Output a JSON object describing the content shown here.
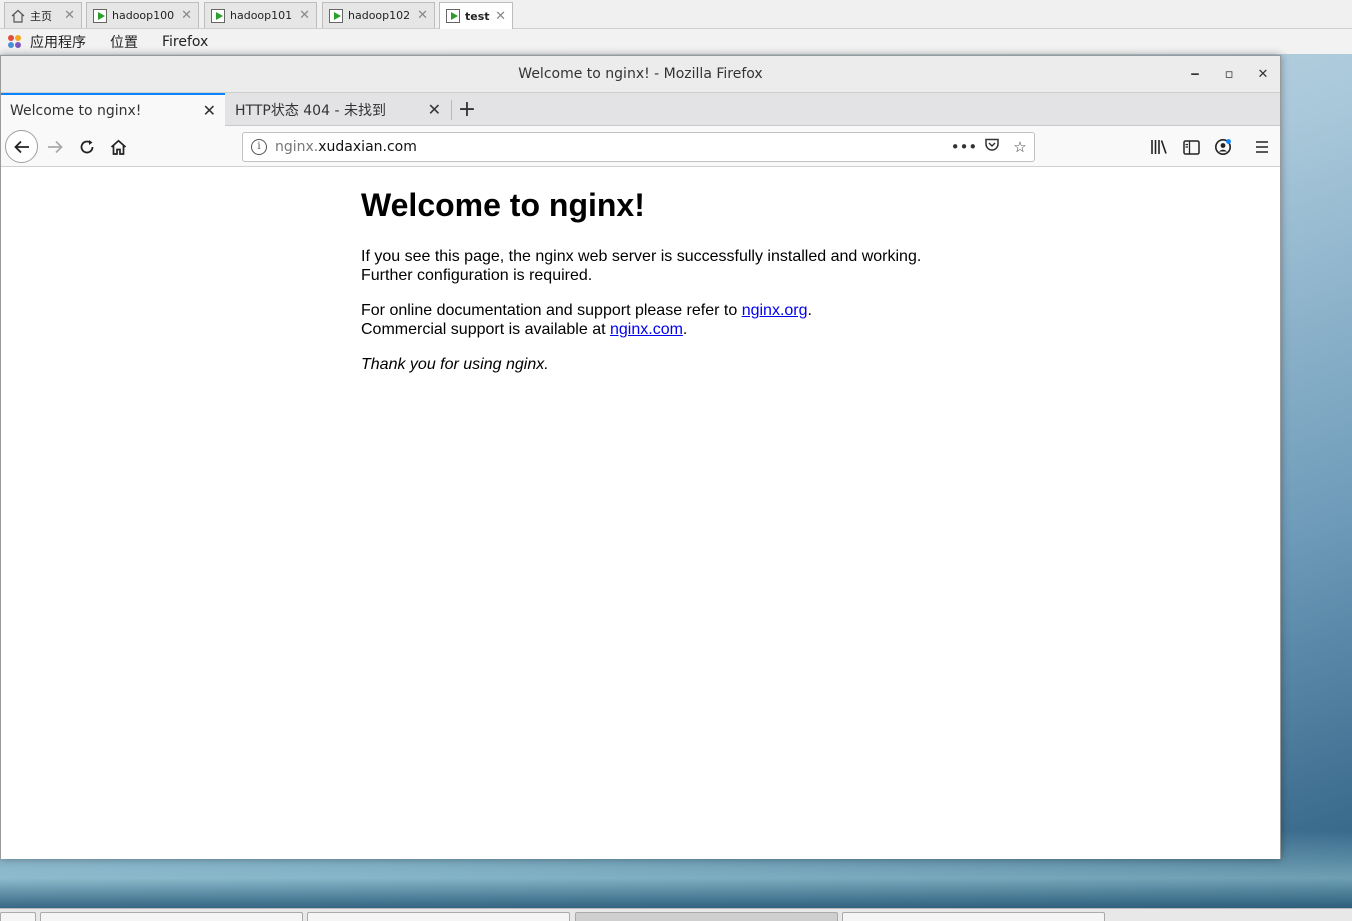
{
  "vm_tabs": [
    {
      "label": "主页",
      "icon": "home-icon",
      "active": false
    },
    {
      "label": "hadoop100",
      "icon": "vm-icon",
      "active": false
    },
    {
      "label": "hadoop101",
      "icon": "vm-icon",
      "active": false
    },
    {
      "label": "hadoop102",
      "icon": "vm-icon",
      "active": false
    },
    {
      "label": "test",
      "icon": "vm-icon",
      "active": true
    }
  ],
  "gnome_bar": {
    "apps": "应用程序",
    "places": "位置",
    "firefox": "Firefox"
  },
  "window": {
    "title": "Welcome to nginx! - Mozilla Firefox",
    "minimize": "‒",
    "maximize": "▫",
    "close": "✕"
  },
  "tabs": [
    {
      "label": "Welcome to nginx!",
      "active": true
    },
    {
      "label": "HTTP状态 404 - 未找到",
      "active": false
    }
  ],
  "newtab": "+",
  "nav": {
    "url_prefix": "nginx.",
    "url_domain": "xudaxian.com",
    "page_actions": "•••"
  },
  "page": {
    "heading": "Welcome to nginx!",
    "p1_line1": "If you see this page, the nginx web server is successfully installed and working.",
    "p1_line2": "Further configuration is required.",
    "p2_text1": "For online documentation and support please refer to ",
    "p2_link1": "nginx.org",
    "p2_text2": ".",
    "p2_text3": "Commercial support is available at ",
    "p2_link2": "nginx.com",
    "p2_text4": ".",
    "p3": "Thank you for using nginx."
  },
  "colors": {
    "link": "#0000ee",
    "active_tab_accent": "#0a84ff"
  }
}
